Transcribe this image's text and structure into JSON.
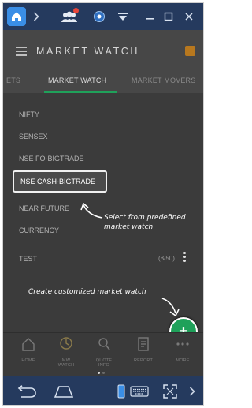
{
  "app": {
    "title": "MARKET WATCH"
  },
  "tabs": [
    {
      "label": "ETS"
    },
    {
      "label": "MARKET WATCH"
    },
    {
      "label": "MARKET MOVERS"
    }
  ],
  "watchlists": [
    {
      "name": "NIFTY"
    },
    {
      "name": "SENSEX"
    },
    {
      "name": "NSE FO-BIGTRADE"
    },
    {
      "name": "NSE CASH-BIGTRADE"
    },
    {
      "name": "NEAR FUTURE"
    },
    {
      "name": "CURRENCY"
    },
    {
      "name": "TEST",
      "count": "(8/50)"
    }
  ],
  "annotations": {
    "predefined": "Select from predefined\nmarket watch",
    "customized": "Create customized market watch"
  },
  "fab": {
    "label": "+"
  },
  "bottom_nav": [
    {
      "label": "HOME",
      "icon": "home-icon"
    },
    {
      "label": "MW\nWATCH",
      "icon": "market-watch-icon"
    },
    {
      "label": "QUOTE\nINFO",
      "icon": "quote-icon"
    },
    {
      "label": "REPORT",
      "icon": "report-icon"
    },
    {
      "label": "MORE",
      "icon": "more-icon"
    }
  ],
  "colors": {
    "accent": "#1fa15a",
    "emulator_bar": "#253a5e",
    "header": "#474747",
    "list_bg": "#3b3b3b"
  }
}
